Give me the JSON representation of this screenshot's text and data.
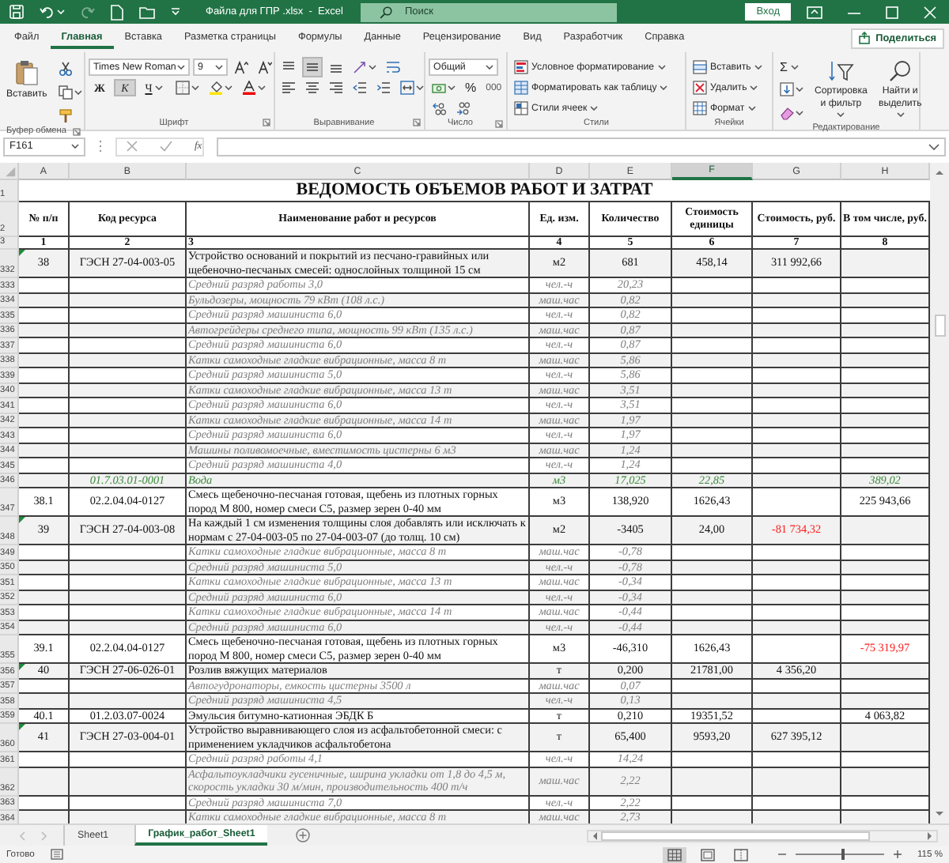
{
  "window": {
    "title": "Файла для ГПР .xlsx  -  Excel",
    "search": {
      "placeholder": "Поиск"
    },
    "sign_in": "Вход"
  },
  "menu_tabs": [
    {
      "label": "Файл",
      "selected": false
    },
    {
      "label": "Главная",
      "selected": true
    },
    {
      "label": "Вставка",
      "selected": false
    },
    {
      "label": "Разметка страницы",
      "selected": false
    },
    {
      "label": "Формулы",
      "selected": false
    },
    {
      "label": "Данные",
      "selected": false
    },
    {
      "label": "Рецензирование",
      "selected": false
    },
    {
      "label": "Вид",
      "selected": false
    },
    {
      "label": "Разработчик",
      "selected": false
    },
    {
      "label": "Справка",
      "selected": false
    }
  ],
  "share": "Поделиться",
  "ribbon": {
    "clipboard": {
      "label": "Буфер обмена",
      "paste": "Вставить"
    },
    "font": {
      "label": "Шрифт",
      "name": "Times New Roman",
      "size": "9",
      "styles": [
        {
          "label": "Ж",
          "on": false
        },
        {
          "label": "К",
          "on": true
        },
        {
          "label": "Ч",
          "on": false
        }
      ]
    },
    "alignment": {
      "label": "Выравнивание",
      "vertical": [
        {
          "selected": false
        },
        {
          "selected": true
        },
        {
          "selected": false
        }
      ]
    },
    "number": {
      "label": "Число",
      "format": "Общий",
      "percent": "%",
      "thousands": "000"
    },
    "styles": {
      "label": "Стили",
      "commands": [
        "Условное форматирование",
        "Форматировать как таблицу",
        "Стили ячеек"
      ]
    },
    "cells": {
      "label": "Ячейки",
      "commands": [
        "Вставить",
        "Удалить",
        "Формат"
      ]
    },
    "editing": {
      "label": "Редактирование",
      "autosum": "Σ",
      "commands": [
        "Сортировка и фильтр",
        "Найти и выделить"
      ]
    }
  },
  "formula_bar": {
    "name_box": "F161",
    "function_button": "fx"
  },
  "sheet": {
    "columns": [
      {
        "label": "A",
        "selected": false
      },
      {
        "label": "B",
        "selected": false
      },
      {
        "label": "C",
        "selected": false
      },
      {
        "label": "D",
        "selected": false
      },
      {
        "label": "E",
        "selected": false
      },
      {
        "label": "F",
        "selected": true
      },
      {
        "label": "G",
        "selected": false
      },
      {
        "label": "H",
        "selected": false
      }
    ],
    "title_row": {
      "number": "1",
      "text": "ВЕДОМОСТЬ ОБЪЕМОВ РАБОТ И ЗАТРАТ"
    },
    "header_row": {
      "number": "2",
      "cells": [
        "№ п/п",
        "Код ресурса",
        "Наименование работ и ресурсов",
        "Ед. изм.",
        "Количество",
        "Стоимость единицы",
        "Стоимость, руб.",
        "В том числе, руб."
      ]
    },
    "index_row": {
      "number": "3",
      "cells": [
        "1",
        "2",
        "3",
        "4",
        "5",
        "6",
        "7",
        "8"
      ]
    },
    "rows": [
      {
        "number": "332",
        "kind": "work",
        "flagged": true,
        "num": "38",
        "code": "ГЭСН 27-04-003-05",
        "name": "Устройство оснований и покрытий из песчано-гравийных или щебеночно-песчаных смесей: однослойных толщиной 15 см",
        "unit": "м2",
        "qty": "681",
        "price": "458,14",
        "cost": "311 992,66"
      },
      {
        "number": "333",
        "kind": "resource",
        "flagged": false,
        "name": "Средний разряд работы 3,0",
        "unit": "чел.-ч",
        "qty": "20,23"
      },
      {
        "number": "334",
        "kind": "resource",
        "flagged": false,
        "name": "Бульдозеры, мощность 79 кВт (108 л.с.)",
        "unit": "маш.час",
        "qty": "0,82"
      },
      {
        "number": "335",
        "kind": "resource",
        "flagged": false,
        "name": "Средний разряд машиниста 6,0",
        "unit": "чел.-ч",
        "qty": "0,82"
      },
      {
        "number": "336",
        "kind": "resource",
        "flagged": false,
        "name": "Автогрейдеры среднего типа, мощность 99 кВт (135 л.с.)",
        "unit": "маш.час",
        "qty": "0,87"
      },
      {
        "number": "337",
        "kind": "resource",
        "flagged": false,
        "name": "Средний разряд машиниста 6,0",
        "unit": "чел.-ч",
        "qty": "0,87"
      },
      {
        "number": "338",
        "kind": "resource",
        "flagged": false,
        "name": "Катки самоходные гладкие вибрационные, масса 8 т",
        "unit": "маш.час",
        "qty": "5,86"
      },
      {
        "number": "339",
        "kind": "resource",
        "flagged": false,
        "name": "Средний разряд машиниста 5,0",
        "unit": "чел.-ч",
        "qty": "5,86"
      },
      {
        "number": "340",
        "kind": "resource",
        "flagged": false,
        "name": "Катки самоходные гладкие вибрационные, масса 13 т",
        "unit": "маш.час",
        "qty": "3,51"
      },
      {
        "number": "341",
        "kind": "resource",
        "flagged": false,
        "name": "Средний разряд машиниста 6,0",
        "unit": "чел.-ч",
        "qty": "3,51"
      },
      {
        "number": "342",
        "kind": "resource",
        "flagged": false,
        "name": "Катки самоходные гладкие вибрационные, масса 14 т",
        "unit": "маш.час",
        "qty": "1,97"
      },
      {
        "number": "343",
        "kind": "resource",
        "flagged": false,
        "name": "Средний разряд машиниста 6,0",
        "unit": "чел.-ч",
        "qty": "1,97"
      },
      {
        "number": "344",
        "kind": "resource",
        "flagged": false,
        "name": "Машины поливомоечные, вместимость цистерны 6 м3",
        "unit": "маш.час",
        "qty": "1,24"
      },
      {
        "number": "345",
        "kind": "resource",
        "flagged": false,
        "name": "Средний разряд машиниста 4,0",
        "unit": "чел.-ч",
        "qty": "1,24"
      },
      {
        "number": "346",
        "kind": "material",
        "flagged": false,
        "code": "01.7.03.01-0001",
        "name": "Вода",
        "unit": "м3",
        "qty": "17,025",
        "price": "22,85",
        "incl": "389,02"
      },
      {
        "number": "347",
        "kind": "work",
        "flagged": false,
        "num": "38.1",
        "code": "02.2.04.04-0127",
        "name": "Смесь щебеночно-песчаная готовая, щебень из плотных горных пород М 800, номер смеси С5, размер зерен 0-40 мм",
        "unit": "м3",
        "qty": "138,920",
        "price": "1626,43",
        "incl": "225 943,66"
      },
      {
        "number": "348",
        "kind": "work",
        "flagged": true,
        "num": "39",
        "code": "ГЭСН 27-04-003-08",
        "name": "На каждый 1 см изменения толщины слоя добавлять или исключать к нормам с 27-04-003-05 по 27-04-003-07 (до толщ. 10 см)",
        "unit": "м2",
        "qty": "-3405",
        "price": "24,00",
        "cost": {
          "text": "-81 734,32",
          "alert": true
        }
      },
      {
        "number": "349",
        "kind": "resource",
        "flagged": false,
        "name": "Катки самоходные гладкие вибрационные, масса 8 т",
        "unit": "маш.час",
        "qty": "-0,78"
      },
      {
        "number": "350",
        "kind": "resource",
        "flagged": false,
        "name": "Средний разряд машиниста 5,0",
        "unit": "чел.-ч",
        "qty": "-0,78"
      },
      {
        "number": "351",
        "kind": "resource",
        "flagged": false,
        "name": "Катки самоходные гладкие вибрационные, масса 13 т",
        "unit": "маш.час",
        "qty": "-0,34"
      },
      {
        "number": "352",
        "kind": "resource",
        "flagged": false,
        "name": "Средний разряд машиниста 6,0",
        "unit": "чел.-ч",
        "qty": "-0,34"
      },
      {
        "number": "353",
        "kind": "resource",
        "flagged": false,
        "name": "Катки самоходные гладкие вибрационные, масса 14 т",
        "unit": "маш.час",
        "qty": "-0,44"
      },
      {
        "number": "354",
        "kind": "resource",
        "flagged": false,
        "name": "Средний разряд машиниста 6,0",
        "unit": "чел.-ч",
        "qty": "-0,44"
      },
      {
        "number": "355",
        "kind": "work",
        "flagged": false,
        "num": "39.1",
        "code": "02.2.04.04-0127",
        "name": "Смесь щебеночно-песчаная готовая, щебень из плотных горных пород М 800, номер смеси С5, размер зерен 0-40 мм",
        "unit": "м3",
        "qty": "-46,310",
        "price": "1626,43",
        "incl": {
          "text": "-75 319,97",
          "alert": true
        }
      },
      {
        "number": "356",
        "kind": "work",
        "flagged": true,
        "num": "40",
        "code": "ГЭСН 27-06-026-01",
        "name": "Розлив вяжущих материалов",
        "unit": "т",
        "qty": "0,200",
        "price": "21781,00",
        "cost": "4 356,20"
      },
      {
        "number": "357",
        "kind": "resource",
        "flagged": false,
        "name": "Автогудронаторы, емкость цистерны 3500 л",
        "unit": "маш.час",
        "qty": "0,07"
      },
      {
        "number": "358",
        "kind": "resource",
        "flagged": false,
        "name": "Средний разряд машиниста 4,5",
        "unit": "чел.-ч",
        "qty": "0,13"
      },
      {
        "number": "359",
        "kind": "work",
        "flagged": false,
        "num": "40.1",
        "code": "01.2.03.07-0024",
        "name": "Эмульсия битумно-катионная ЭБДК Б",
        "unit": "т",
        "qty": "0,210",
        "price": "19351,52",
        "incl": "4 063,82"
      },
      {
        "number": "360",
        "kind": "work",
        "flagged": true,
        "num": "41",
        "code": "ГЭСН 27-03-004-01",
        "name": "Устройство выравнивающего слоя из асфальтобетонной смеси: с применением укладчиков асфальтобетона",
        "unit": "т",
        "qty": "65,400",
        "price": "9593,20",
        "cost": "627 395,12"
      },
      {
        "number": "361",
        "kind": "resource",
        "flagged": false,
        "name": "Средний разряд работы 4,1",
        "unit": "чел.-ч",
        "qty": "14,24"
      },
      {
        "number": "362",
        "kind": "resource",
        "flagged": false,
        "name": "Асфальтоукладчики гусеничные, ширина укладки от 1,8 до 4,5 м, скорость укладки 30 м/мин, производительность 400 т/ч",
        "unit": "маш.час",
        "qty": "2,22"
      },
      {
        "number": "363",
        "kind": "resource",
        "flagged": false,
        "name": "Средний разряд машиниста 7,0",
        "unit": "чел.-ч",
        "qty": "2,22"
      },
      {
        "number": "364",
        "kind": "resource",
        "flagged": false,
        "name": "Катки самоходные гладкие вибрационные, масса 8 т",
        "unit": "маш.час",
        "qty": "2,73"
      }
    ]
  },
  "sheet_tabs": [
    {
      "label": "Sheet1",
      "selected": false
    },
    {
      "label": "График_работ_Sheet1",
      "selected": true
    }
  ],
  "status_bar": {
    "status": "Готово",
    "views": [
      {
        "selected": true
      },
      {
        "selected": false
      },
      {
        "selected": false
      }
    ],
    "zoom_slider": {
      "level": 0.53
    },
    "zoom": "115 %"
  }
}
